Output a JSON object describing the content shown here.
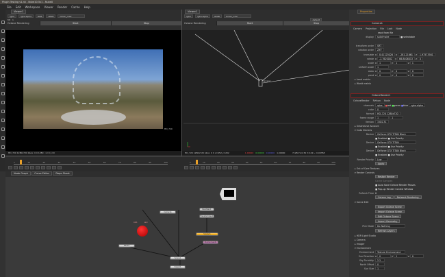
{
  "window": {
    "title": "Plugin Testing v1.nk - Nuke10.5v1 - NukeX"
  },
  "menu": [
    "File",
    "Edit",
    "Workspace",
    "Viewer",
    "Render",
    "Cache",
    "Help"
  ],
  "viewer1": {
    "tab": "Viewer1",
    "channels": "rgba",
    "alpha": "rgba.alpha",
    "colorspace": "RGB",
    "lut": "sRGB",
    "node": "Octan_nder",
    "zoom": "f/8",
    "frame": "1",
    "octane_label": "Octane Rendering",
    "start": "Start",
    "stop": "Stop",
    "format_label": "HD_720",
    "status": "HD_720 1280x720  bbox: 0 0 1280 : x=0 y=0",
    "fps": "24*",
    "mode": "TF",
    "play": "Global"
  },
  "viewer2": {
    "tab": "Viewer1",
    "channels": "rgba",
    "alpha": "rgba.alpha",
    "lut": "sRGB",
    "node": "Octan_nder",
    "view": "default",
    "octane_label": "Octane Rendering",
    "start": "Start",
    "stop": "Stop",
    "camera_label": "Camera1",
    "status": "HD_720 1280x720  bbox: 0 0  x=452 y=202",
    "r": "1.00000",
    "g": "0.00000",
    "b": "0.00000",
    "a": "1.00000",
    "hsvl": "H:282 S:0.39 V:0.01  L: 0.00358"
  },
  "timeline": {
    "ticks": [
      "1",
      "10",
      "20",
      "30",
      "40",
      "50",
      "60",
      "70",
      "80",
      "90",
      "100"
    ],
    "end": "100",
    "current_frame": 5,
    "range": [
      1,
      100
    ]
  },
  "node_graph": {
    "tabs": [
      "Node Graph",
      "Curve Editor",
      "Dope Sheet"
    ],
    "nodes": {
      "read": "Read1",
      "viewer": "Viewer1",
      "camera": "Camera1",
      "octane": "OctaneRender1",
      "scene": "Scene1",
      "geo": "ReadGeo1",
      "axis": "Axis1",
      "transform": "TransformGeo1",
      "shader": "Shader1",
      "env": "Environment1"
    },
    "labels": {
      "bg": "BG",
      "cam": "cam",
      "img": "img",
      "obj": "obj",
      "env": "env"
    }
  },
  "properties": {
    "tab": "Properties",
    "camera": {
      "name": "Camera1",
      "tabs": [
        "Camera",
        "Projection",
        "File",
        "Lock",
        "Node"
      ],
      "read_from_file": "read from file",
      "display_label": "display",
      "display": "solid+wire",
      "selectable": "selectable",
      "transform_order_label": "transform order",
      "transform_order": "SRT",
      "rotation_order_label": "rotation order",
      "rotation_order": "ZXY",
      "translate_label": "translate",
      "translate": [
        "8.41123026",
        "-281.21661",
        "1.97573561"
      ],
      "rotate_label": "rotate",
      "rotate": [
        "-2.7620002",
        "66.8406013",
        "0"
      ],
      "scale_label": "scale",
      "scale": [
        "1",
        "1",
        "1"
      ],
      "uniform_scale_label": "uniform scale",
      "uniform_scale": "1",
      "skew_label": "skew",
      "skew": [
        "0",
        "0",
        "0"
      ],
      "pivot_label": "pivot",
      "pivot": [
        "0",
        "0",
        "0"
      ],
      "local_matrix": "Local matrix",
      "world_matrix": "World matrix"
    },
    "octane": {
      "name": "OctaneRender1",
      "tabs": [
        "OctaneRender",
        "Python",
        "Node"
      ],
      "channels_label": "channels",
      "channels": "rgba",
      "red": "red",
      "green": "green",
      "blue": "blue",
      "alpha": "rgba.alpha",
      "color_label": "color",
      "color": "0",
      "format_label": "format",
      "format": "HD_720 1280x720",
      "frame_range_label": "frame range",
      "frame_start": "1",
      "frame_end": "1",
      "version_label": "Version",
      "version": "3.6.0.31",
      "live_account": "OctaneLive Account",
      "cuda_devices": "Cuda Devices",
      "devices": [
        {
          "label": "Device",
          "name": "GeForce GTX TITAN Black",
          "enabled": "Enabled",
          "priority": "Use Priority"
        },
        {
          "label": "Device",
          "name": "GeForce GTX TITAN",
          "enabled": "Enabled",
          "priority": "Use Priority"
        },
        {
          "label": "Device",
          "name": "GeForce GTX TITAN Black",
          "enabled": "Enabled",
          "priority": "Use Priority"
        }
      ],
      "render_priority_label": "Render Priority",
      "render_priority": "Low",
      "apply": "Apply",
      "out_of_core": "Out of Core Textures",
      "render_controls": "Render Controls",
      "restart_render": "Restart Render",
      "cache_samples": "Cache Samples",
      "auto_save": "Auto Save Octane Render Passes",
      "popup": "Pop-up Render Control Window",
      "refresh_label": "Refresh Time",
      "refresh": "0",
      "octane_log": "Octane Log",
      "network_rendering": "Network Rendering",
      "scene_edit": "Scene Edit",
      "export_scene": "Export Octane Scene",
      "import_scene": "Import Octane Scene",
      "edit_scene": "Edit Octane Scene",
      "import_geo": "Import Geometry",
      "pick_mode_label": "Pick Mode",
      "pick_mode": "Do Nothing",
      "refresh_layers": "Refresh Layers",
      "hdr_light": "HDR Light Studio",
      "camera_sec": "Camera",
      "imager": "Imager",
      "environment": "Environment",
      "env_label": "Environment",
      "env_value": "Texture Environment",
      "sun_dir_label": "Sun Direction",
      "sun_dir": [
        "0",
        "1",
        "0"
      ],
      "sky_turb_label": "Sky Turbidity",
      "sky_turb": "2.2",
      "north_label": "North Offset",
      "north": "0",
      "sun_size_label": "Sun Size",
      "sun_size": "1"
    }
  },
  "colors": {
    "accent": "#e8a02a",
    "node_red": "#c80000",
    "node_header": "#7a2222"
  }
}
